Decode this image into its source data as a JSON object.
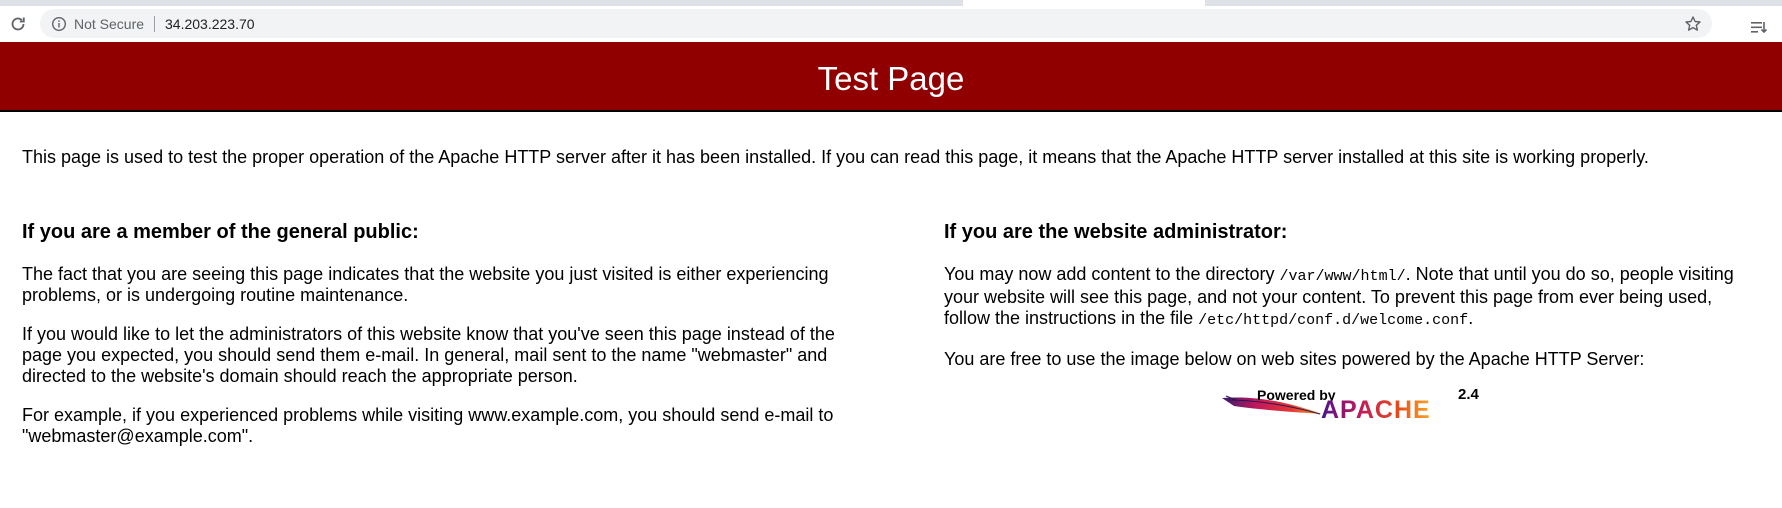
{
  "browser": {
    "security_label": "Not Secure",
    "url": "34.203.223.70"
  },
  "page": {
    "title": "Test Page",
    "intro": "This page is used to test the proper operation of the Apache HTTP server after it has been installed. If you can read this page, it means that the Apache HTTP server installed at this site is working properly.",
    "public": {
      "heading": "If you are a member of the general public:",
      "p1": "The fact that you are seeing this page indicates that the website you just visited is either experiencing problems, or is undergoing routine maintenance.",
      "p2": "If you would like to let the administrators of this website know that you've seen this page instead of the page you expected, you should send them e-mail. In general, mail sent to the name \"webmaster\" and directed to the website's domain should reach the appropriate person.",
      "p3": "For example, if you experienced problems while visiting www.example.com, you should send e-mail to \"webmaster@example.com\"."
    },
    "admin": {
      "heading": "If you are the website administrator:",
      "p1_a": "You may now add content to the directory ",
      "p1_dir": "/var/www/html/",
      "p1_b": ". Note that until you do so, people visiting your website will see this page, and not your content. To prevent this page from ever being used, follow the instructions in the file ",
      "p1_file": "/etc/httpd/conf.d/welcome.conf",
      "p1_c": ".",
      "p2": "You are free to use the image below on web sites powered by the Apache HTTP Server:"
    },
    "logo": {
      "powered_by": "Powered by",
      "version": "2.4",
      "name": "APACHE"
    }
  },
  "colors": {
    "banner": "#900000",
    "omnibox": "#f1f3f4"
  }
}
